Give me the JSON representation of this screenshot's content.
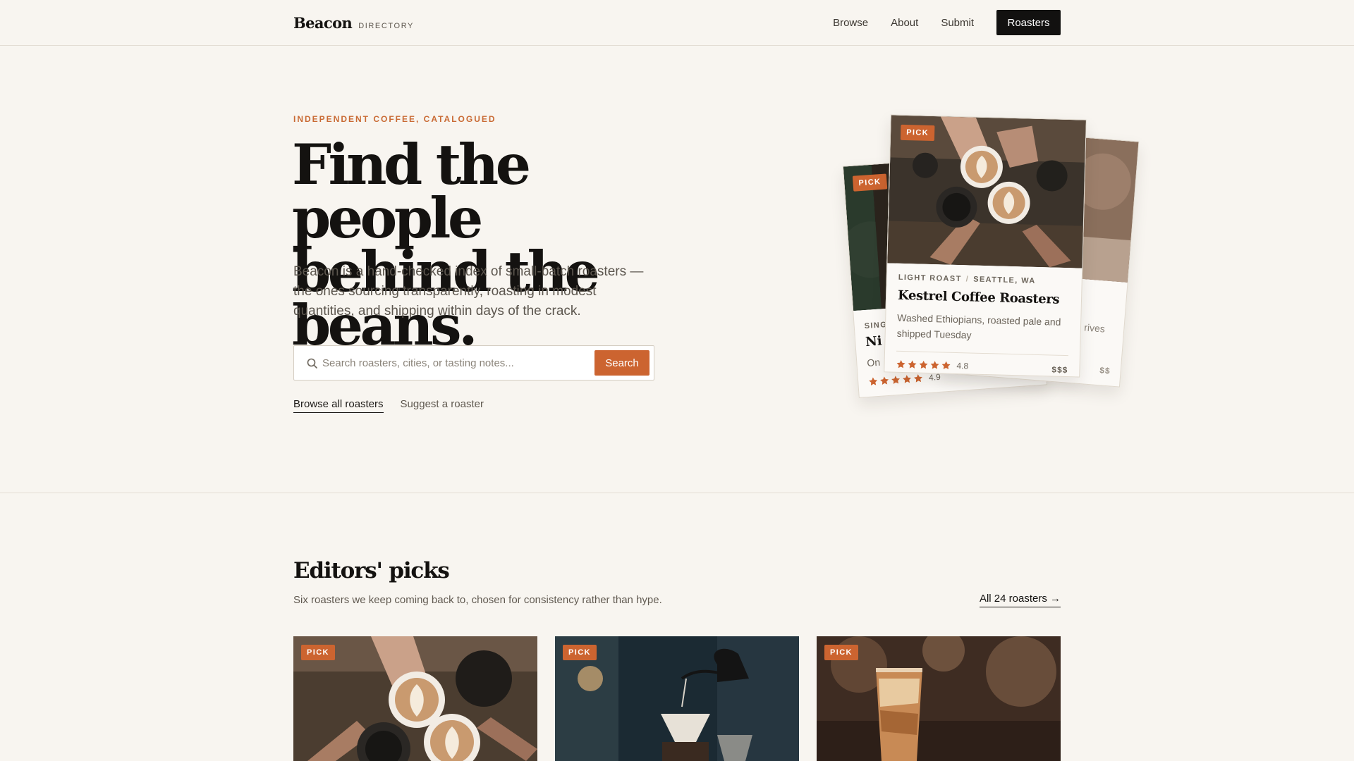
{
  "header": {
    "brand_name": "Beacon",
    "brand_sub": "DIRECTORY",
    "nav": [
      {
        "label": "Browse"
      },
      {
        "label": "About"
      },
      {
        "label": "Submit"
      }
    ],
    "cta_label": "Roasters"
  },
  "hero": {
    "eyebrow": "INDEPENDENT COFFEE, CATALOGUED",
    "headline_line1": "Find the people",
    "headline_line2": "behind the beans.",
    "lede": "Beacon is a hand-checked index of small-batch roasters — the ones sourcing transparently, roasting in modest quantities, and shipping within days of the crack.",
    "search": {
      "placeholder": "Search roasters, cities, or tasting notes...",
      "button_label": "Search"
    },
    "links": {
      "primary": "Browse all roasters",
      "secondary": "Suggest a roaster"
    }
  },
  "card_stack": {
    "badge": "PICK",
    "front": {
      "roast": "LIGHT ROAST",
      "separator": "/",
      "location": "SEATTLE, WA",
      "name": "Kestrel Coffee Roasters",
      "description": "Washed Ethiopians, roasted pale and shipped Tuesday",
      "rating": "4.8",
      "rating_value": 4.8,
      "price": "$$$"
    },
    "left": {
      "meta_partial": "SING",
      "name_partial": "Ni",
      "desc_partial": "On",
      "rating": "4.9",
      "rating_value": 4.9,
      "price": "$$$$"
    },
    "right": {
      "desc_partial": "rives",
      "price": "$$"
    }
  },
  "picks": {
    "title": "Editors' picks",
    "subtitle": "Six roasters we keep coming back to, chosen for consistency rather than hype.",
    "all_link": "All 24 roasters",
    "arrow": "→",
    "cards": [
      {
        "badge": "PICK"
      },
      {
        "badge": "PICK"
      },
      {
        "badge": "PICK"
      }
    ]
  },
  "colors": {
    "accent": "#cc6430",
    "background": "#f8f5f0",
    "ink": "#141210"
  },
  "icons": {
    "search": "search-icon",
    "star": "star-icon",
    "arrow": "arrow-right-icon"
  }
}
